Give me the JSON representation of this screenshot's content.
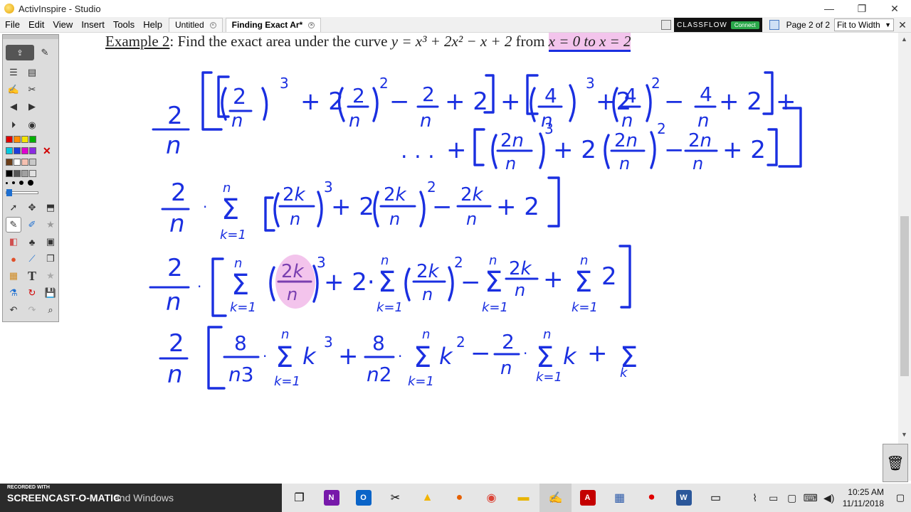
{
  "window": {
    "title": "ActivInspire - Studio",
    "minimize": "—",
    "restore": "❐",
    "close": "✕"
  },
  "menu": [
    "File",
    "Edit",
    "View",
    "Insert",
    "Tools",
    "Help"
  ],
  "tabs": [
    {
      "label": "Untitled",
      "active": false
    },
    {
      "label": "Finding Exact Ar*",
      "active": true
    }
  ],
  "classflow": {
    "label": "CLASSFLOW",
    "connect": "Connect"
  },
  "pager": {
    "label": "Page 2 of 2",
    "zoom": "Fit to Width"
  },
  "heading": {
    "prefix": "Example 2",
    "text": ": Find the exact area under the curve ",
    "func": "y = x³ + 2x² − x + 2",
    "from": "from ",
    "interval": "x = 0 to x = 2"
  },
  "taskbar": {
    "recorded": "RECORDED WITH",
    "brand": "SCREENCAST-O-MATIC",
    "search_text": "and Windows",
    "time": "10:25 AM",
    "date": "11/11/2018"
  },
  "colors": {
    "ink": "#1a2fe0",
    "highlight": "#f3c4ec"
  }
}
